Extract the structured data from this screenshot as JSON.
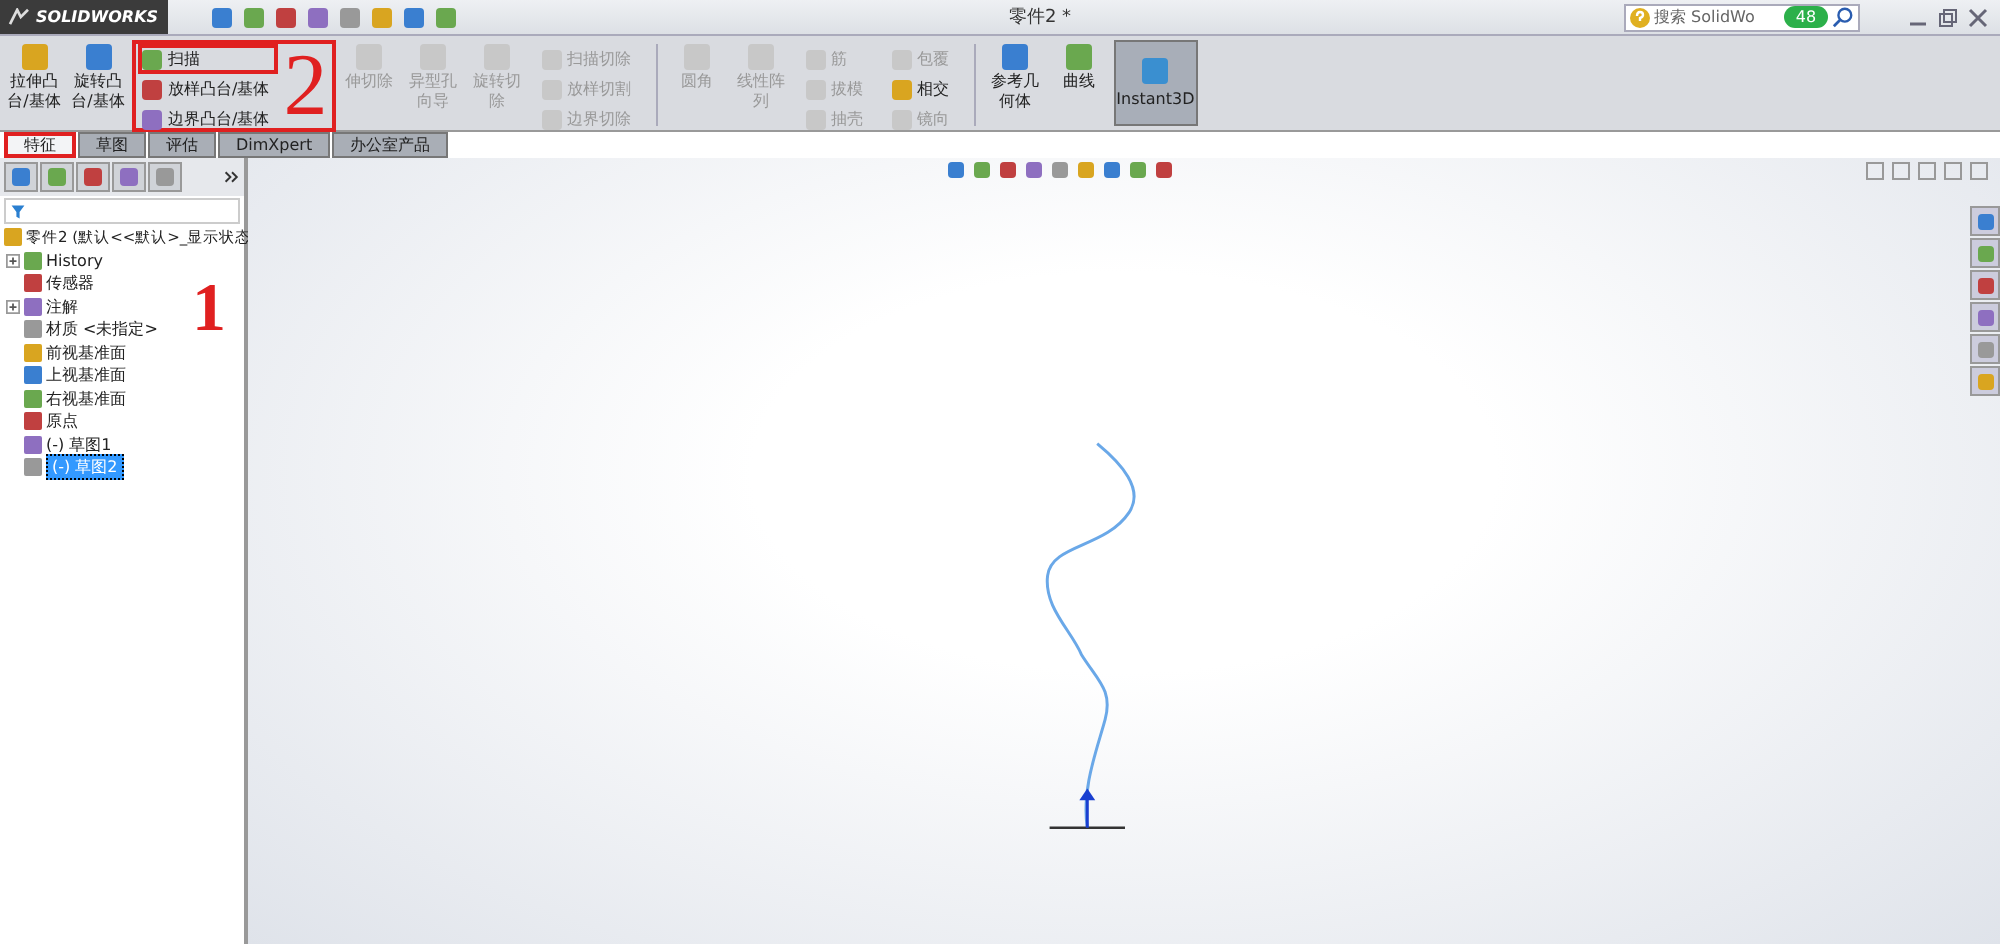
{
  "window": {
    "app": "SOLIDWORKS",
    "title": "零件2 *"
  },
  "search": {
    "placeholder": "搜索 SolidWo",
    "badge": "48"
  },
  "ribbon": [
    {
      "kind": "big",
      "label": "拉伸凸台/基体",
      "disabled": false
    },
    {
      "kind": "big",
      "label": "旋转凸台/基体",
      "disabled": false
    },
    {
      "kind": "stack",
      "highlighted": true,
      "items": [
        {
          "label": "扫描",
          "disabled": false,
          "highlighted": true
        },
        {
          "label": "放样凸台/基体",
          "disabled": false,
          "highlighted": false
        },
        {
          "label": "边界凸台/基体",
          "disabled": false,
          "highlighted": false
        }
      ]
    },
    {
      "kind": "big",
      "label": "伸切除",
      "disabled": true
    },
    {
      "kind": "big",
      "label": "异型孔向导",
      "disabled": true
    },
    {
      "kind": "big",
      "label": "旋转切除",
      "disabled": true
    },
    {
      "kind": "stack",
      "highlighted": false,
      "items": [
        {
          "label": "扫描切除",
          "disabled": true,
          "highlighted": false
        },
        {
          "label": "放样切割",
          "disabled": true,
          "highlighted": false
        },
        {
          "label": "边界切除",
          "disabled": true,
          "highlighted": false
        }
      ]
    },
    {
      "kind": "sep"
    },
    {
      "kind": "big",
      "label": "圆角",
      "disabled": true
    },
    {
      "kind": "big",
      "label": "线性阵列",
      "disabled": true
    },
    {
      "kind": "stack",
      "highlighted": false,
      "items": [
        {
          "label": "筋",
          "disabled": true,
          "highlighted": false
        },
        {
          "label": "拔模",
          "disabled": true,
          "highlighted": false
        },
        {
          "label": "抽壳",
          "disabled": true,
          "highlighted": false
        }
      ]
    },
    {
      "kind": "stack",
      "highlighted": false,
      "items": [
        {
          "label": "包覆",
          "disabled": true,
          "highlighted": false
        },
        {
          "label": "相交",
          "disabled": false,
          "highlighted": false
        },
        {
          "label": "镜向",
          "disabled": true,
          "highlighted": false
        }
      ]
    },
    {
      "kind": "sep"
    },
    {
      "kind": "big",
      "label": "参考几何体",
      "disabled": false
    },
    {
      "kind": "big",
      "label": "曲线",
      "disabled": false
    },
    {
      "kind": "toggle",
      "label": "Instant3D",
      "selected": true
    }
  ],
  "tabs": [
    {
      "label": "特征",
      "selected": true,
      "highlighted": true
    },
    {
      "label": "草图",
      "selected": false,
      "highlighted": false
    },
    {
      "label": "评估",
      "selected": false,
      "highlighted": false
    },
    {
      "label": "DimXpert",
      "selected": false,
      "highlighted": false
    },
    {
      "label": "办公室产品",
      "selected": false,
      "highlighted": false
    }
  ],
  "tree": {
    "root": "零件2 (默认<<默认>_显示状态",
    "items": [
      {
        "label": "History",
        "expandable": true,
        "selected": false
      },
      {
        "label": "传感器",
        "expandable": false,
        "selected": false
      },
      {
        "label": "注解",
        "expandable": true,
        "selected": false
      },
      {
        "label": "材质 <未指定>",
        "expandable": false,
        "selected": false
      },
      {
        "label": "前视基准面",
        "expandable": false,
        "selected": false
      },
      {
        "label": "上视基准面",
        "expandable": false,
        "selected": false
      },
      {
        "label": "右视基准面",
        "expandable": false,
        "selected": false
      },
      {
        "label": "原点",
        "expandable": false,
        "selected": false
      },
      {
        "label": "(-) 草图1",
        "expandable": false,
        "selected": false
      },
      {
        "label": "(-) 草图2",
        "expandable": false,
        "selected": true
      }
    ]
  },
  "annotations": [
    "1",
    "2"
  ]
}
